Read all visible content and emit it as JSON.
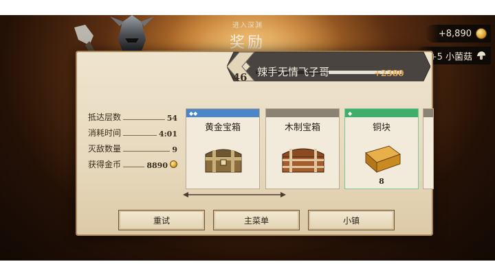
{
  "header": {
    "subtitle": "进入深渊",
    "title": "奖励"
  },
  "currencies": [
    {
      "value": "+8,890",
      "icon": "gold-coin-icon"
    },
    {
      "value": "+5 小菌菇",
      "icon": "mushroom-icon"
    }
  ],
  "player": {
    "level": "46",
    "name": "辣手无情飞子哥",
    "xp_gain": "+2380",
    "xp_progress": 0.5
  },
  "stats": [
    {
      "label": "抵达层数",
      "value": "54"
    },
    {
      "label": "消耗时间",
      "value": "4:01"
    },
    {
      "label": "灭敌数量",
      "value": "9"
    },
    {
      "label": "获得金币",
      "value": "8890"
    }
  ],
  "rewards": [
    {
      "name": "黄金宝箱",
      "strip_color": "#4a86c8",
      "badge": "◆◆",
      "quantity": "",
      "icon": "gold-chest-icon"
    },
    {
      "name": "木制宝箱",
      "strip_color": "#8c8273",
      "badge": "",
      "quantity": "",
      "icon": "wood-chest-icon"
    },
    {
      "name": "铜块",
      "strip_color": "#3fae6a",
      "badge": "◆",
      "quantity": "8",
      "icon": "copper-ingot-icon"
    }
  ],
  "buttons": {
    "retry": "重试",
    "main_menu": "主菜单",
    "town": "小镇"
  },
  "colors": {
    "accent_gold": "#d9a32b",
    "panel": "#e9dcc2",
    "banner_dark": "#4a4440"
  }
}
